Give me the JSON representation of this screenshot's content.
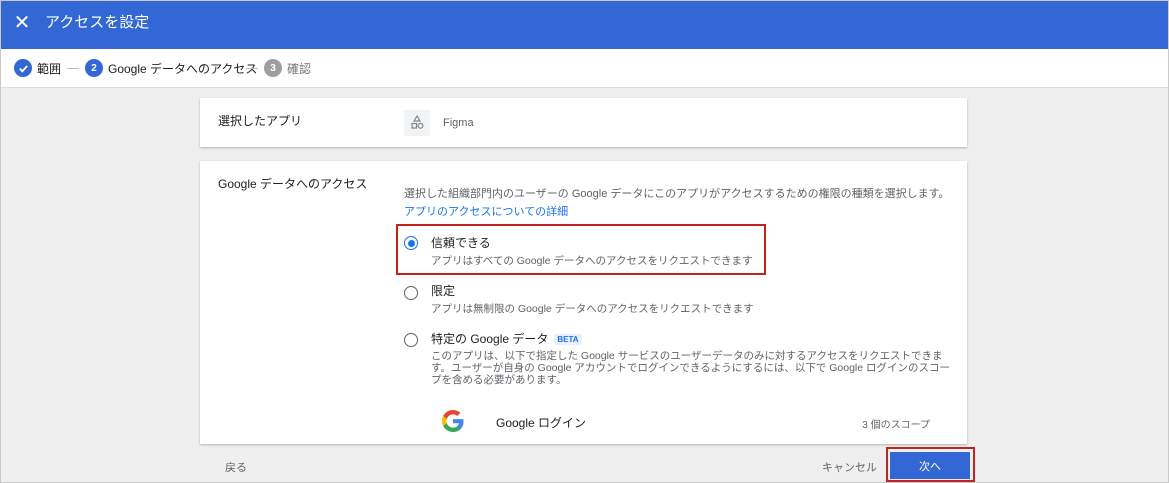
{
  "dialog": {
    "title": "アクセスを設定",
    "close_icon": "close-icon"
  },
  "stepper": {
    "steps": [
      {
        "number": "1",
        "label": "範囲",
        "state": "done"
      },
      {
        "number": "2",
        "label": "Google データへのアクセス",
        "state": "active"
      },
      {
        "number": "3",
        "label": "確認",
        "state": "pending"
      }
    ]
  },
  "selected_app": {
    "label": "選択したアプリ",
    "app_name": "Figma",
    "icon": "app-shapes-icon"
  },
  "access": {
    "label": "Google データへのアクセス",
    "description": "選択した組織部門内のユーザーの Google データにこのアプリがアクセスするための権限の種類を選択します。",
    "link": "アプリのアクセスについての詳細",
    "options": [
      {
        "title": "信頼できる",
        "subtitle": "アプリはすべての Google データへのアクセスをリクエストできます",
        "selected": true
      },
      {
        "title": "限定",
        "subtitle": "アプリは無制限の Google データへのアクセスをリクエストできます",
        "selected": false
      },
      {
        "title": "特定の Google データ",
        "badge": "BETA",
        "subtitle": "このアプリは、以下で指定した Google サービスのユーザーデータのみに対するアクセスをリクエストできます。ユーザーが自身の Google アカウントでログインできるようにするには、以下で Google ログインのスコープを含める必要があります。",
        "selected": false
      }
    ],
    "google_signin": {
      "label": "Google ログイン",
      "scope": "3 個のスコープ"
    }
  },
  "footer": {
    "back": "戻る",
    "cancel": "キャンセル",
    "next": "次へ"
  },
  "colors": {
    "header": "#3367d6",
    "accent": "#1a73e8",
    "highlight": "#c5221f"
  }
}
